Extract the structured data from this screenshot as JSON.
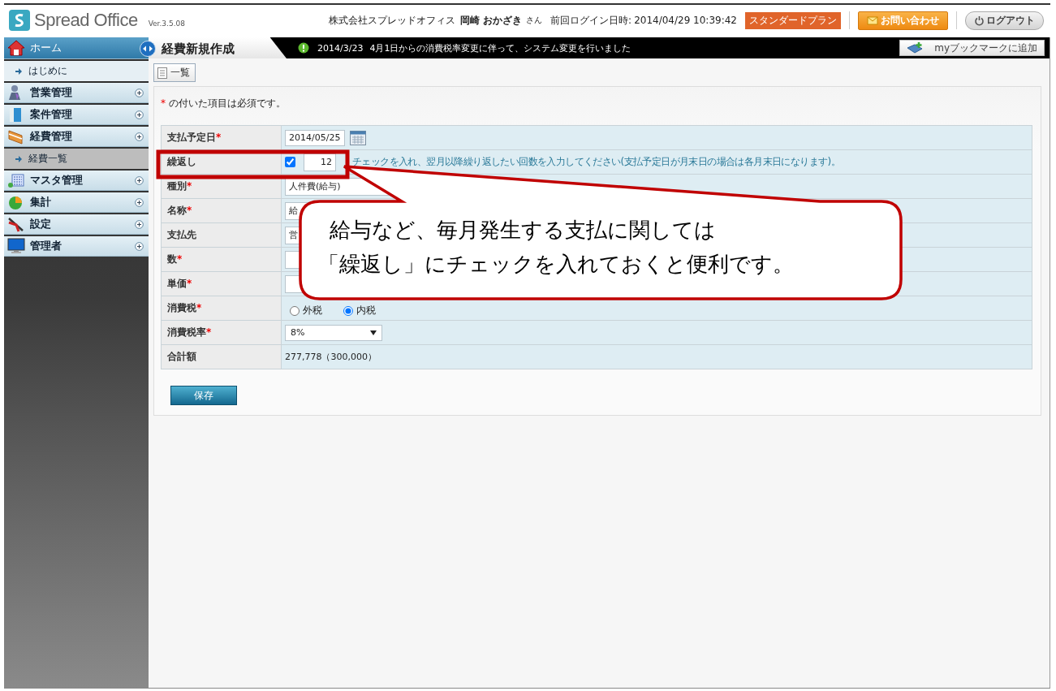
{
  "header": {
    "logo_text": "Spread Office",
    "version": "Ver.3.5.08",
    "company": "株式会社スプレッドオフィス",
    "user": "岡崎 おかざき",
    "honorific": "さん",
    "last_login_label": "前回ログイン日時:",
    "last_login": "2014/04/29 10:39:42",
    "plan_badge": "スタンダードプラン",
    "contact_button": "お問い合わせ",
    "logout_button": "ログアウト"
  },
  "sidebar": {
    "items": [
      {
        "label": "ホーム",
        "selected": true,
        "children": [
          {
            "label": "はじめに",
            "selected": false
          }
        ]
      },
      {
        "label": "営業管理",
        "selected": false
      },
      {
        "label": "案件管理",
        "selected": false
      },
      {
        "label": "経費管理",
        "selected": false,
        "children": [
          {
            "label": "経費一覧",
            "selected": true
          }
        ]
      },
      {
        "label": "マスタ管理",
        "selected": false
      },
      {
        "label": "集計",
        "selected": false
      },
      {
        "label": "設定",
        "selected": false
      },
      {
        "label": "管理者",
        "selected": false
      }
    ]
  },
  "tab_bar": {
    "page_title": "経費新規作成",
    "notice_date": "2014/3/23",
    "notice_text": "4月1日からの消費税率変更に伴って、システム変更を行いました",
    "bookmark_button": "myブックマークに追加"
  },
  "toolbar": {
    "list_button": "一覧"
  },
  "form": {
    "note": {
      "mark": "*",
      "text": " の付いた項目は必須です。"
    },
    "rows": [
      {
        "label": "支払予定日",
        "required_mark": "*",
        "kind": "date",
        "value": "2014/05/25"
      },
      {
        "label": "繰返し",
        "kind": "repeat",
        "checked": true,
        "value": "12",
        "hint": "チェックを入れ、翌月以降繰り返したい回数を入力してください(支払予定日が月末日の場合は各月末日になります)。"
      },
      {
        "label": "種別",
        "required_mark": "*",
        "kind": "text",
        "value": "人件費(給与)"
      },
      {
        "label": "名称",
        "required_mark": "*",
        "kind": "text",
        "value": "給"
      },
      {
        "label": "支払先",
        "kind": "text",
        "value": "営"
      },
      {
        "label": "数",
        "required_mark": "*",
        "kind": "text"
      },
      {
        "label": "単価",
        "required_mark": "*",
        "kind": "text"
      },
      {
        "label": "消費税",
        "required_mark": "*",
        "kind": "radio",
        "options": [
          {
            "label": "外税",
            "selected": false
          },
          {
            "label": "内税",
            "selected": true
          }
        ]
      },
      {
        "label": "消費税率",
        "required_mark": "*",
        "kind": "select",
        "value": "8%"
      },
      {
        "label": "合計額",
        "kind": "static",
        "value": "277,778（300,000）"
      }
    ],
    "save_button": "保存"
  },
  "callout": {
    "lines": [
      "給与など、毎月発生する支払に関しては",
      "「繰返し」にチェックを入れておくと便利です。"
    ]
  }
}
